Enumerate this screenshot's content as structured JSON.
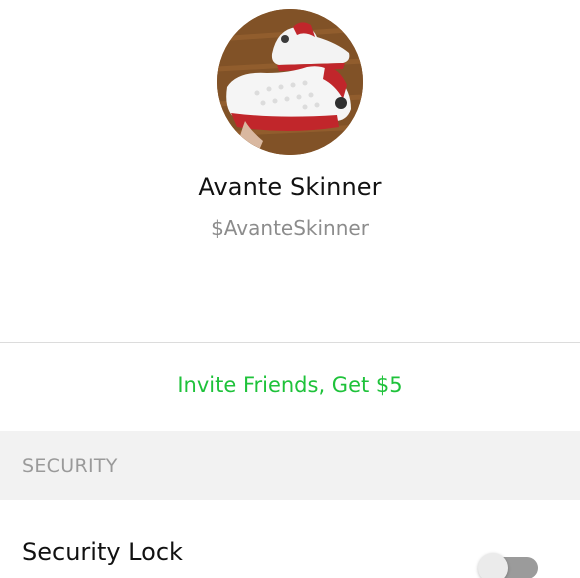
{
  "profile": {
    "name": "Avante Skinner",
    "handle": "$AvanteSkinner",
    "avatar_icon": "sneakers-photo"
  },
  "invite": {
    "label": "Invite Friends, Get $5",
    "color": "#1ec23a"
  },
  "security_section": {
    "header": "SECURITY",
    "items": [
      {
        "label": "Security Lock",
        "enabled": false
      }
    ]
  }
}
